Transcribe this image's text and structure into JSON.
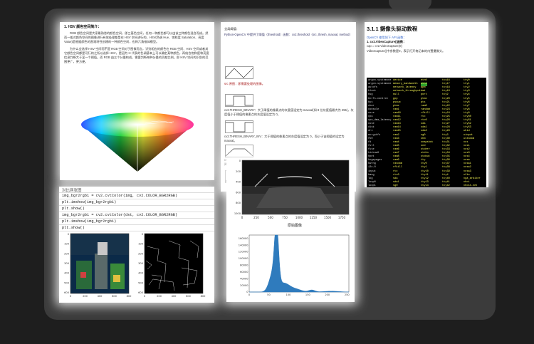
{
  "page_left": {
    "heading": "1. HSV 颜色空间简介：",
    "paragraph1": "RGB 颜色空间是大家最熟悉的颜色空间，即三基色空间，任何一种颜色都可以由该三种颜色混合而成。然而一般对颜色空间的图像进行有效处理都是在 HSV 空间进行的，HSV(色调 Hue、饱和度 Saturation、亮度 Value)是根据颜色的直观特性创建的一种颜色空间，也称六角锥体模型。",
    "paragraph2": "为什么会选择 HSV 空间而不是 RGB 空间对于图像而言，识别相应的颜色在 RGB 空间、HSV 空间或者其它颜色空间都是可行的之所以选择 HSV，是因为 H 代表的色调基本上可以确定某种颜色，再结合饱和度和亮度信息判断大于某一个阈值。而 RGB 由三个分量构成，需要判断每种分量的贡献比例。即 HSV 空间的识别的范围更广，更方便。"
  },
  "page_mid": {
    "title": "全局阈值：",
    "line1": "Python-OpenCV 中提供了阈值（threshold）函数：cv2.threshold（src, thresh, maxval, method）",
    "line2": "src 原图：即需要处理的图像。",
    "notes": [
      "cv2.THRESH_BINARY：大于阈值的像素点的灰度值设定为 maxval(如 8 位灰度值最大为 255)，灰度值小于阈值的像素点的灰度值设定为 0。",
      "cv2.THRESH_BINARY_INV：大于阈值的像素点的灰度值设定为 0，而小于该阈值的设定为 maxval。",
      "cv2.THRESH_TRUNC：像素点的灰度值小于阈值不改变，大于阈值的灰度值的像素点就设定为该阈值。"
    ]
  },
  "page_right": {
    "title": "3.1.1 摄像头驱动教程",
    "lines": [
      "OpenCV 使用如下 API 函数：",
      "1. cv2.VideoCapture()函数：",
      "cap = cv2.VideoCapture(0)",
      "VideoCapture()中参数是0，表示打开笔记本的内置摄像头。"
    ],
    "terminal_rows": [
      [
        "argon-systemone",
        "device",
        "eth0",
        "tty16",
        "tty0"
      ],
      [
        "argon-systemone",
        "memory_bandwidth",
        "eth1",
        "tty17",
        "tty1"
      ],
      [
        "autofs",
        "network_latency",
        "apm",
        "tty18",
        "tty2"
      ],
      [
        "block",
        "network_throughput",
        "dmt",
        "tty19",
        "tty3"
      ],
      [
        "bsg",
        "null",
        "port",
        "tty2",
        "tty4"
      ],
      [
        "btrfs-control",
        "ppp",
        "ptmx",
        "tty20",
        "tty5"
      ],
      [
        "bus",
        "psaux",
        "pts",
        "tty21",
        "tty6"
      ],
      [
        "char",
        "ptmx",
        "ram0",
        "tty22",
        "tty7"
      ],
      [
        "console",
        "ram1",
        "random",
        "tty23",
        "tty8"
      ],
      [
        "core",
        "ram10",
        "rfkill",
        "tty24",
        "tty9"
      ],
      [
        "cpu",
        "ram11",
        "rtc",
        "tty25",
        "ttyS0"
      ],
      [
        "cpu_dma_latency",
        "ram12",
        "rtc0",
        "tty26",
        "ttyS1"
      ],
      [
        "cuse",
        "ram13",
        "sda",
        "tty27",
        "ttyS2"
      ],
      [
        "disk",
        "ram14",
        "sda1",
        "tty28",
        "ttyS3"
      ],
      [
        "dri",
        "ram15",
        "sda2",
        "tty29",
        "uhid"
      ],
      [
        "ecryptfs",
        "ram2",
        "sg0",
        "tty3",
        "uinput"
      ],
      [
        "fb0",
        "ram3",
        "shm",
        "tty30",
        "urandom"
      ],
      [
        "fd",
        "ram4",
        "snapshot",
        "tty31",
        "vcs"
      ],
      [
        "full",
        "ram5",
        "snd",
        "tty32",
        "vcs1"
      ],
      [
        "fuse",
        "ram6",
        "stderr",
        "tty33",
        "vcs2"
      ],
      [
        "hidraw0",
        "ram7",
        "stdin",
        "tty34",
        "vcs3"
      ],
      [
        "hpet",
        "ram8",
        "stdout",
        "tty35",
        "vcs4"
      ],
      [
        "hugepages",
        "ram9",
        "tty",
        "tty36",
        "vcsa"
      ],
      [
        "hwrng",
        "random",
        "tty0",
        "tty37",
        "vcsa1"
      ],
      [
        "i2c-0",
        "rfkill",
        "tty1",
        "tty38",
        "vcsa2"
      ],
      [
        "input",
        "rtc",
        "tty10",
        "tty39",
        "vcsa3"
      ],
      [
        "kmsg",
        "rtc0",
        "tty11",
        "tty4",
        "vfio"
      ],
      [
        "log",
        "sda",
        "tty12",
        "tty40",
        "vga_arbiter"
      ],
      [
        "loop0",
        "sda1",
        "tty13",
        "tty41",
        "vhci"
      ],
      [
        "loop1",
        "sg0",
        "tty14",
        "tty42",
        "vhost-net"
      ],
      [
        "loop2",
        "shm",
        "tty15",
        "tty43",
        "video0"
      ],
      [
        "mapper",
        "snapshot",
        "tty16",
        "tty44",
        "zero"
      ]
    ]
  },
  "page_code": {
    "header": "对比两张图",
    "lines": [
      "img_bgr2rgb1 = cv2.cvtColor(img, cv2.COLOR_BGR2RGB)",
      "plt.imshow(img_bgr2rgb1)",
      "plt.show()",
      "img_bgr2rgb1 = cv2.cvtColor(dst, cv2.COLOR_BGR2RGB)",
      "plt.imshow(img_bgr2rgb1)",
      "plt.show()"
    ],
    "left_plot_ticks_x": [
      "0",
      "200",
      "400",
      "600",
      "800"
    ],
    "right_plot_ticks_x": [
      "0",
      "200",
      "400",
      "600",
      "800"
    ],
    "plot_ticks_y": [
      "0",
      "100",
      "200",
      "300",
      "400",
      "500",
      "600"
    ]
  },
  "page_hist": {
    "image_caption": "原始图像",
    "image_ticks_x": [
      "0",
      "250",
      "500",
      "750",
      "1000",
      "1250",
      "1500",
      "1750"
    ],
    "image_ticks_y": [
      "0",
      "200",
      "400",
      "600",
      "800",
      "1000"
    ],
    "hist_ticks_y": [
      "0",
      "20000",
      "40000",
      "60000",
      "80000",
      "100000",
      "120000",
      "140000",
      "160000"
    ],
    "hist_ticks_x": [
      "0",
      "50",
      "100",
      "150",
      "200",
      "250"
    ],
    "hist_color": "#2f7bbd"
  }
}
